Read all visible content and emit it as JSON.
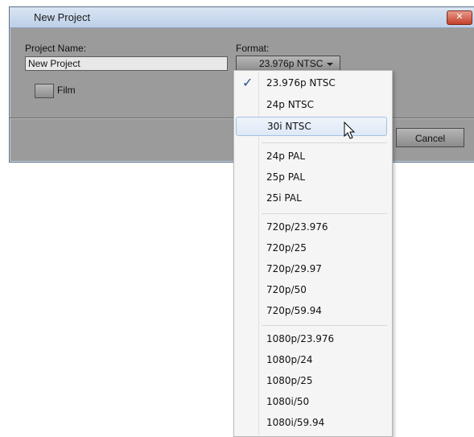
{
  "window": {
    "title": "New Project",
    "close_icon": "close-icon"
  },
  "form": {
    "project_name_label": "Project Name:",
    "project_name_value": "New Project",
    "format_label": "Format:",
    "format_selected": "23.976p NTSC",
    "film_label": "Film",
    "film_checked": false
  },
  "buttons": {
    "cancel": "Cancel"
  },
  "format_menu": {
    "groups": [
      {
        "items": [
          {
            "label": "23.976p NTSC",
            "checked": true
          },
          {
            "label": "24p NTSC"
          },
          {
            "label": "30i NTSC",
            "highlighted": true
          }
        ]
      },
      {
        "items": [
          {
            "label": "24p PAL"
          },
          {
            "label": "25p PAL"
          },
          {
            "label": "25i PAL"
          }
        ]
      },
      {
        "items": [
          {
            "label": "720p/23.976"
          },
          {
            "label": "720p/25"
          },
          {
            "label": "720p/29.97"
          },
          {
            "label": "720p/50"
          },
          {
            "label": "720p/59.94"
          }
        ]
      },
      {
        "items": [
          {
            "label": "1080p/23.976"
          },
          {
            "label": "1080p/24"
          },
          {
            "label": "1080p/25"
          },
          {
            "label": "1080i/50"
          },
          {
            "label": "1080i/59.94"
          }
        ]
      }
    ]
  },
  "icons": {
    "checkmark": "checkmark-icon",
    "dropdown_arrow": "chevron-down-icon",
    "cursor": "mouse-pointer-icon"
  }
}
